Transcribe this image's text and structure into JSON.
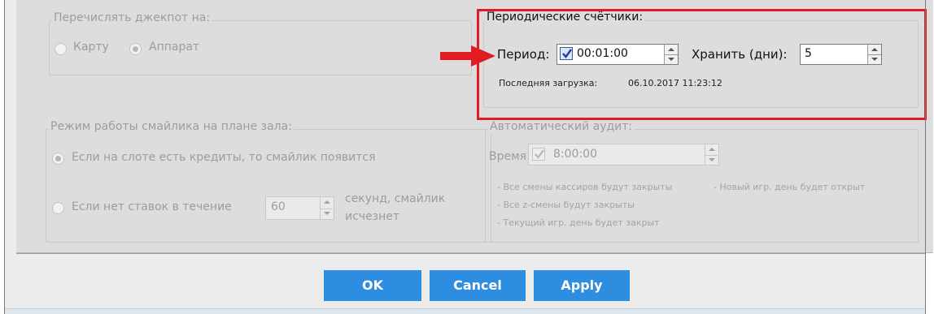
{
  "jackpot": {
    "legend": "Перечислять джекпот на:",
    "option_card": "Карту",
    "option_machine": "Аппарат"
  },
  "counters": {
    "legend": "Периодические счётчики:",
    "period_label": "Период:",
    "period_value": "00:01:00",
    "period_enabled": true,
    "keep_label": "Хранить (дни):",
    "keep_value": "5",
    "last_load_label": "Последняя загрузка:",
    "last_load_value": "06.10.2017 11:23:12"
  },
  "smiley": {
    "legend": "Режим работы смайлика на плане зала:",
    "option_credits": "Если на слоте есть кредиты, то смайлик появится",
    "option_no_bets": "Если нет ставок в течение",
    "seconds_value": "60",
    "seconds_suffix": "секунд, смайлик исчезнет"
  },
  "audit": {
    "legend": "Автоматический аудит:",
    "time_label": "Время:",
    "time_value": "8:00:00",
    "notes": [
      "- Все смены кассиров будут закрыты",
      "- Новый игр. день будет открыт",
      "- Все z-смены будут закрыты",
      "- Текущий игр. день будет закрыт"
    ]
  },
  "buttons": {
    "ok": "OK",
    "cancel": "Cancel",
    "apply": "Apply"
  },
  "colors": {
    "button_blue": "#2d8de0",
    "highlight_red": "#e11b22",
    "panel_gray": "#dddddd"
  }
}
